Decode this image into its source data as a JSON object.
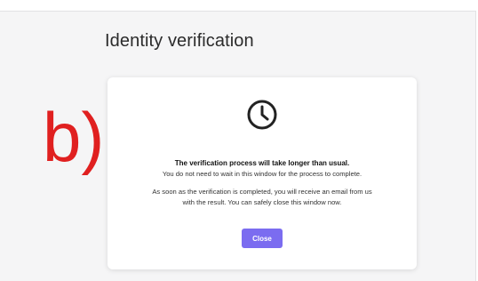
{
  "page": {
    "title": "Identity verification"
  },
  "dialog": {
    "icon": "clock-icon",
    "message_strong": "The verification process will take longer than usual.",
    "message_line1": "You do not need to wait in this window for the process to complete.",
    "message_line2": "As soon as the verification is completed, you will receive an email from us",
    "message_line3": "with the result. You can safely close this window now.",
    "close_label": "Close",
    "accent_color": "#7b6cf0"
  },
  "annotation": {
    "label": "b)",
    "color": "#e02020"
  }
}
